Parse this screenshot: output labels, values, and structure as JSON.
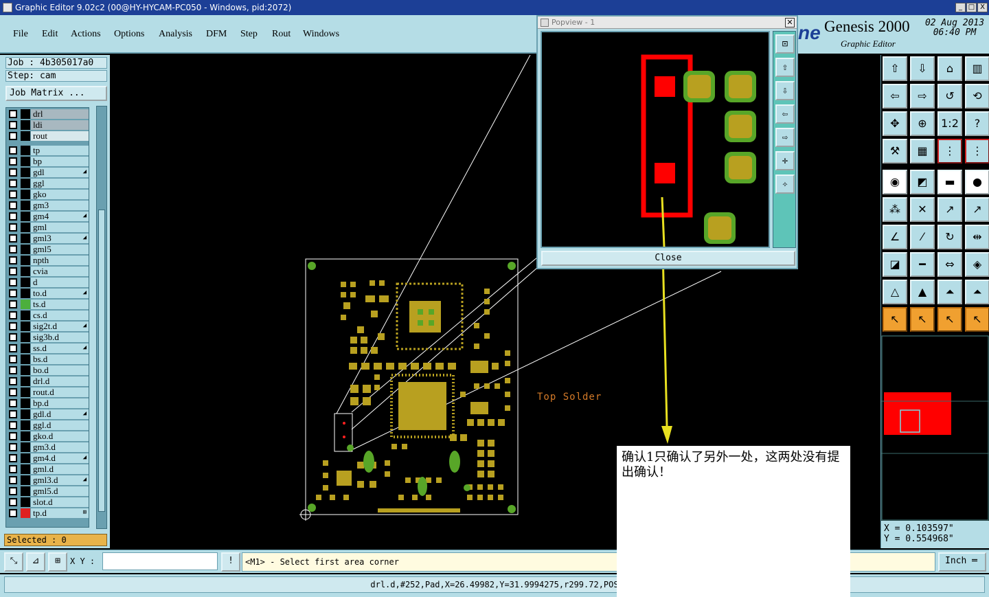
{
  "window": {
    "title": "Graphic Editor 9.02c2 (00@HY-HYCAM-PC050 - Windows, pid:2072)",
    "controls": [
      "_",
      "□",
      "X"
    ]
  },
  "menu": {
    "items": [
      "File",
      "Edit",
      "Actions",
      "Options",
      "Analysis",
      "DFM",
      "Step",
      "Rout",
      "Windows"
    ]
  },
  "brand": {
    "logo_text": "ne",
    "product": "Genesis 2000",
    "subtitle": "Graphic Editor",
    "date": "02 Aug 2013",
    "time": "06:40 PM"
  },
  "job": {
    "job_label": "Job : 4b305017a0",
    "step_label": "Step: cam",
    "matrix_button": "Job Matrix ..."
  },
  "layers": {
    "top_group": [
      {
        "name": "drl",
        "style": "gray"
      },
      {
        "name": "ldi",
        "style": "gray"
      },
      {
        "name": "rout",
        "style": "light"
      }
    ],
    "list": [
      {
        "name": "tp",
        "flag": ""
      },
      {
        "name": "bp",
        "flag": ""
      },
      {
        "name": "gdl",
        "flag": "◢"
      },
      {
        "name": "ggl",
        "flag": ""
      },
      {
        "name": "gko",
        "flag": ""
      },
      {
        "name": "gm3",
        "flag": ""
      },
      {
        "name": "gm4",
        "flag": "◢"
      },
      {
        "name": "gml",
        "flag": ""
      },
      {
        "name": "gml3",
        "flag": "◢"
      },
      {
        "name": "gml5",
        "flag": ""
      },
      {
        "name": "npth",
        "flag": ""
      },
      {
        "name": "cvia",
        "flag": ""
      },
      {
        "name": "d",
        "flag": ""
      },
      {
        "name": "to.d",
        "flag": "◢"
      },
      {
        "name": "ts.d",
        "flag": "",
        "mark": "#4caf3c"
      },
      {
        "name": "cs.d",
        "flag": ""
      },
      {
        "name": "sig2t.d",
        "flag": "◢"
      },
      {
        "name": "sig3b.d",
        "flag": ""
      },
      {
        "name": "ss.d",
        "flag": "◢"
      },
      {
        "name": "bs.d",
        "flag": ""
      },
      {
        "name": "bo.d",
        "flag": ""
      },
      {
        "name": "drl.d",
        "flag": ""
      },
      {
        "name": "rout.d",
        "flag": ""
      },
      {
        "name": "bp.d",
        "flag": ""
      },
      {
        "name": "gdl.d",
        "flag": "◢"
      },
      {
        "name": "ggl.d",
        "flag": ""
      },
      {
        "name": "gko.d",
        "flag": ""
      },
      {
        "name": "gm3.d",
        "flag": ""
      },
      {
        "name": "gm4.d",
        "flag": "◢"
      },
      {
        "name": "gml.d",
        "flag": ""
      },
      {
        "name": "gml3.d",
        "flag": "◢"
      },
      {
        "name": "gml5.d",
        "flag": ""
      },
      {
        "name": "slot.d",
        "flag": ""
      },
      {
        "name": "tp.d",
        "flag": "⊞",
        "mark": "#e02020"
      }
    ],
    "selected_label": "Selected : 0"
  },
  "popview": {
    "title": "Popview - 1",
    "close_label": "Close"
  },
  "canvas": {
    "board_label": "Top Solder"
  },
  "coordinates": {
    "x": "X = 0.103597\"",
    "y": "Y = 0.554968\""
  },
  "command": {
    "xy_label": "X Y :",
    "xy_value": "",
    "prompt": "<M1> - Select first area corner",
    "unit": "Inch"
  },
  "status": {
    "text": "drl.d,#252,Pad,X=26.49982,Y=31.9994275,r299.72,POS"
  },
  "annotation": {
    "text": "确认1只确认了另外一处，这两处没有提出确认！"
  },
  "colors": {
    "panel": "#b5dde6",
    "highlight_red": "#ff0000",
    "pad_gold": "#b8a020",
    "pad_green": "#58a628",
    "arrow_yellow": "#e8e020",
    "outline_white": "#ffffff"
  }
}
